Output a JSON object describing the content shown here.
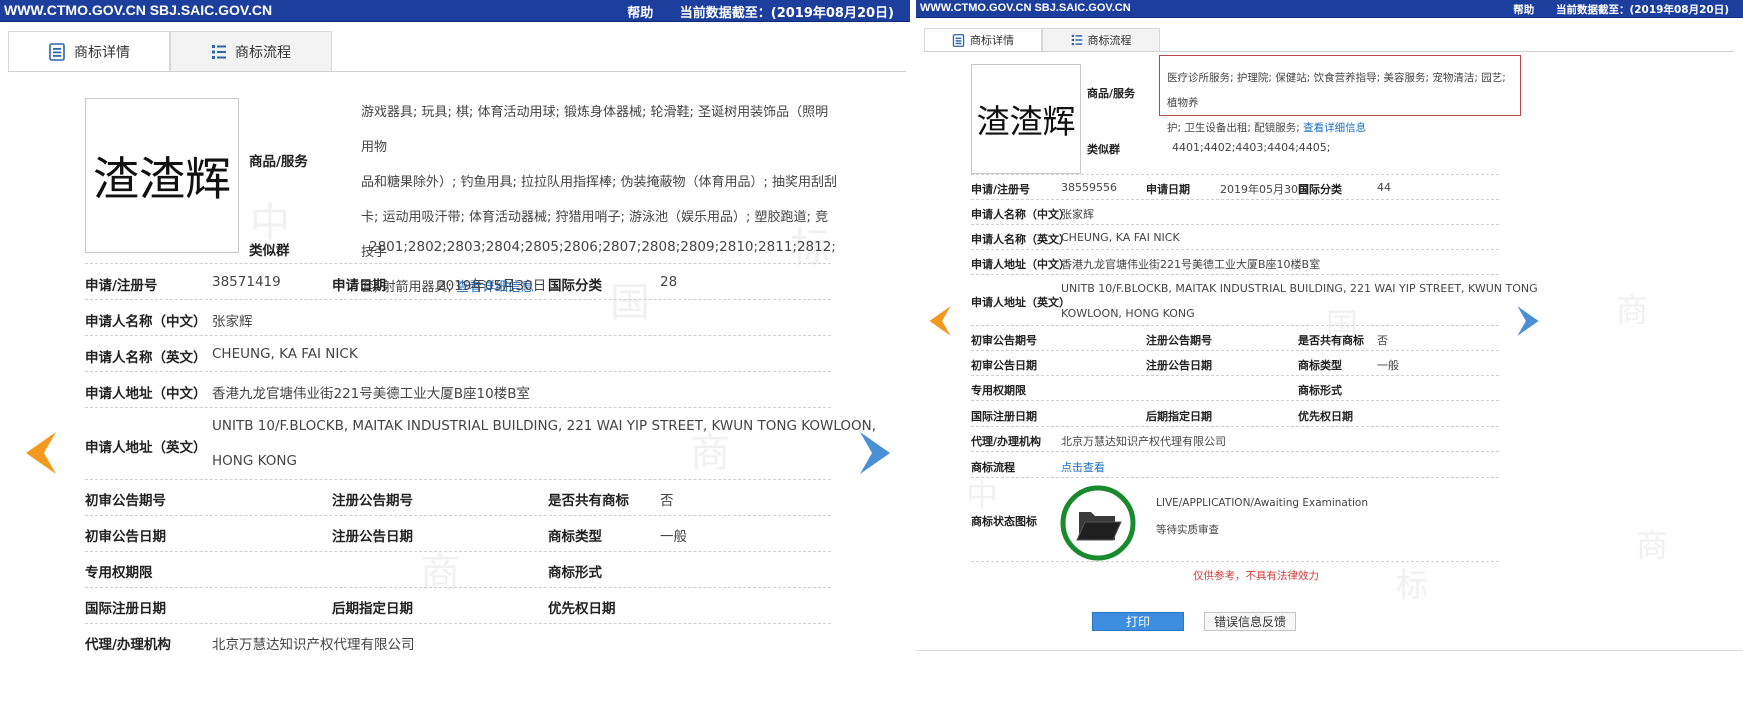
{
  "header": {
    "site": "WWW.CTMO.GOV.CN SBJ.SAIC.GOV.CN",
    "help": "帮助",
    "data_date": "当前数据截至：(2019年08月20日)"
  },
  "tabs": {
    "detail": "商标详情",
    "flow": "商标流程"
  },
  "left": {
    "mark_text": "渣渣辉",
    "goods_label": "商品/服务",
    "goods_lines": [
      "游戏器具; 玩具; 棋; 体育活动用球; 锻炼身体器械; 轮滑鞋; 圣诞树用装饰品（照明用物",
      "品和糖果除外）; 钓鱼用具; 拉拉队用指挥棒; 伪装掩蔽物（体育用品）; 抽奖用刮刮",
      "卡; 运动用吸汗带; 体育活动器械; 狩猎用哨子; 游泳池（娱乐用品）; 塑胶跑道; 竞技手",
      "套; 射箭用器具; "
    ],
    "goods_link": "查看详细信息",
    "similar_label": "类似群",
    "similar_value": "2801;2802;2803;2804;2805;2806;2807;2808;2809;2810;2811;2812;",
    "reg_no_label": "申请/注册号",
    "reg_no": "38571419",
    "apply_date_label": "申请日期",
    "apply_date": "2019年05月30日",
    "intl_class_label": "国际分类",
    "intl_class": "28",
    "applicant_cn_label": "申请人名称（中文）",
    "applicant_cn": "张家辉",
    "applicant_en_label": "申请人名称（英文）",
    "applicant_en": "CHEUNG, KA FAI NICK",
    "address_cn_label": "申请人地址（中文）",
    "address_cn": "香港九龙官塘伟业街221号美德工业大厦B座10楼B室",
    "address_en_label": "申请人地址（英文）",
    "address_en_1": "UNITB 10/F.BLOCKB, MAITAK INDUSTRIAL BUILDING, 221 WAI YIP STREET, KWUN TONG KOWLOON,",
    "address_en_2": "HONG KONG",
    "prelim_no_label": "初审公告期号",
    "reg_pub_no_label": "注册公告期号",
    "shared_label": "是否共有商标",
    "shared": "否",
    "prelim_date_label": "初审公告日期",
    "reg_pub_date_label": "注册公告日期",
    "mark_type_label": "商标类型",
    "mark_type": "一般",
    "exclusive_label": "专用权期限",
    "mark_form_label": "商标形式",
    "intl_reg_date_label": "国际注册日期",
    "later_date_label": "后期指定日期",
    "priority_date_label": "优先权日期",
    "agent_label": "代理/办理机构",
    "agent": "北京万慧达知识产权代理有限公司"
  },
  "right": {
    "mark_text": "渣渣辉",
    "goods_label": "商品/服务",
    "goods_lines": [
      "医疗诊所服务; 护理院; 保健站; 饮食营养指导; 美容服务; 宠物清洁; 园艺; 植物养",
      "护; 卫生设备出租; 配镜服务; "
    ],
    "goods_link": "查看详细信息",
    "similar_label": "类似群",
    "similar_value": "4401;4402;4403;4404;4405;",
    "reg_no_label": "申请/注册号",
    "reg_no": "38559556",
    "apply_date_label": "申请日期",
    "apply_date": "2019年05月30日",
    "intl_class_label": "国际分类",
    "intl_class": "44",
    "applicant_cn_label": "申请人名称（中文）",
    "applicant_cn": "张家辉",
    "applicant_en_label": "申请人名称（英文）",
    "applicant_en": "CHEUNG, KA FAI NICK",
    "address_cn_label": "申请人地址（中文）",
    "address_cn": "香港九龙官塘伟业街221号美德工业大厦B座10楼B室",
    "address_en_label": "申请人地址（英文）",
    "address_en_1": "UNITB 10/F.BLOCKB, MAITAK INDUSTRIAL BUILDING, 221 WAI YIP STREET, KWUN TONG",
    "address_en_2": "KOWLOON, HONG KONG",
    "prelim_no_label": "初审公告期号",
    "reg_pub_no_label": "注册公告期号",
    "shared_label": "是否共有商标",
    "shared": "否",
    "prelim_date_label": "初审公告日期",
    "reg_pub_date_label": "注册公告日期",
    "mark_type_label": "商标类型",
    "mark_type": "一般",
    "exclusive_label": "专用权期限",
    "mark_form_label": "商标形式",
    "intl_reg_date_label": "国际注册日期",
    "later_date_label": "后期指定日期",
    "priority_date_label": "优先权日期",
    "agent_label": "代理/办理机构",
    "agent": "北京万慧达知识产权代理有限公司",
    "flow_label": "商标流程",
    "flow_link": "点击查看",
    "status_label": "商标状态图标",
    "status_en": "LIVE/APPLICATION/Awaiting Examination",
    "status_cn": "等待实质审查",
    "disclaimer": "仅供参考，不具有法律效力",
    "print_button": "打印",
    "feedback_button": "错误信息反馈"
  },
  "watermark": [
    "中",
    "国",
    "商",
    "标"
  ],
  "colors": {
    "header_bg": "#1c3f9e",
    "link": "#1a6dc4",
    "arrow_left": "#f39a1e",
    "arrow_right": "#4b8fd6",
    "highlight_box": "#b8474d",
    "status_ring": "#1a8a2e",
    "print_button": "#3d8de0",
    "disclaimer": "#d23a3a"
  }
}
